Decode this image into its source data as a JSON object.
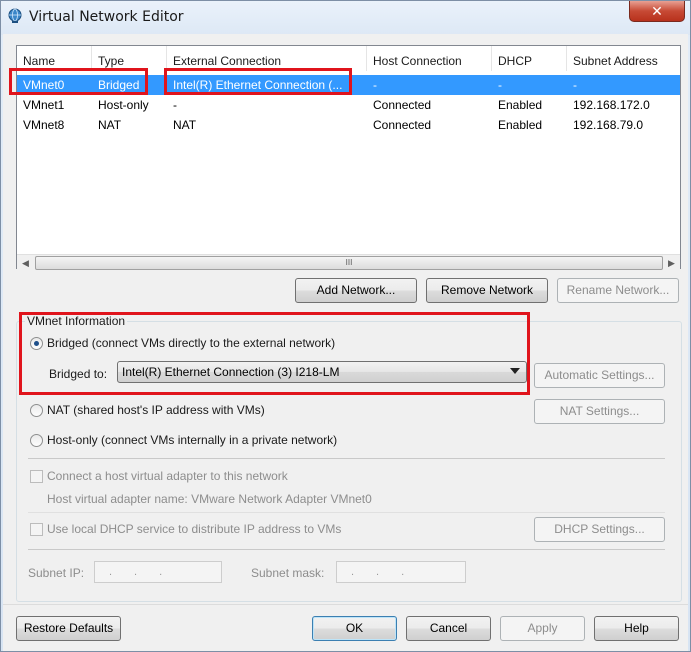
{
  "window": {
    "title": "Virtual Network Editor",
    "close_glyph": "✕"
  },
  "colors": {
    "selection": "#3399ff",
    "highlight": "#e0141c"
  },
  "table": {
    "headers": [
      "Name",
      "Type",
      "External Connection",
      "Host Connection",
      "DHCP",
      "Subnet Address"
    ],
    "rows": [
      [
        "VMnet0",
        "Bridged",
        "Intel(R) Ethernet Connection (...",
        "-",
        "-",
        "-"
      ],
      [
        "VMnet1",
        "Host-only",
        "-",
        "Connected",
        "Enabled",
        "192.168.172.0"
      ],
      [
        "VMnet8",
        "NAT",
        "NAT",
        "Connected",
        "Enabled",
        "192.168.79.0"
      ]
    ],
    "selected_row": 0,
    "scroll_thumb_glyph": "III",
    "scroll_left_glyph": "◀",
    "scroll_right_glyph": "▶"
  },
  "network_buttons": {
    "add": "Add Network...",
    "remove": "Remove Network",
    "rename": "Rename Network..."
  },
  "vmnet_info": {
    "group_label": "VMnet Information",
    "bridged_label": "Bridged (connect VMs directly to the external network)",
    "bridged_to_label": "Bridged to:",
    "bridged_to_value": "Intel(R) Ethernet Connection (3) I218-LM",
    "automatic_settings": "Automatic Settings...",
    "nat_label": "NAT (shared host's IP address with VMs)",
    "nat_settings": "NAT Settings...",
    "hostonly_label": "Host-only (connect VMs internally in a private network)",
    "connect_adapter_label": "Connect a host virtual adapter to this network",
    "adapter_name_label": "Host virtual adapter name: VMware Network Adapter VMnet0",
    "dhcp_label": "Use local DHCP service to distribute IP address to VMs",
    "dhcp_settings": "DHCP Settings...",
    "subnet_ip_label": "Subnet IP:",
    "subnet_mask_label": "Subnet mask:",
    "ip_placeholder": "...",
    "selected_mode": "bridged"
  },
  "footer": {
    "restore": "Restore Defaults",
    "ok": "OK",
    "cancel": "Cancel",
    "apply": "Apply",
    "help": "Help"
  }
}
